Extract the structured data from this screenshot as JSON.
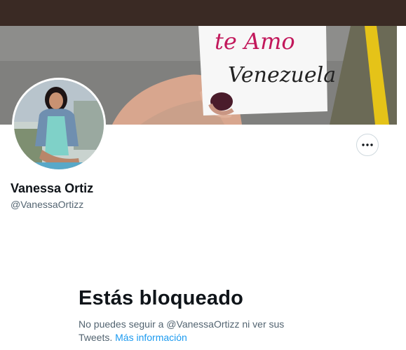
{
  "banner": {
    "card_line1": "te Amo",
    "card_line2": "Venezuela",
    "card_line1_color": "#c2185b",
    "card_line2_color": "#222222",
    "curb_color": "#e5c318"
  },
  "profile": {
    "name": "Vanessa Ortiz",
    "handle": "@VanessaOrtizz",
    "more_icon": "more-horizontal-icon"
  },
  "blocked": {
    "title": "Estás bloqueado",
    "message": "No puedes seguir a @VanessaOrtizz ni ver sus Tweets.",
    "link_text": "Más información"
  },
  "colors": {
    "topbar": "#3a2a24",
    "link": "#1d9bf0",
    "text_primary": "#0f1419",
    "text_secondary": "#536471"
  }
}
